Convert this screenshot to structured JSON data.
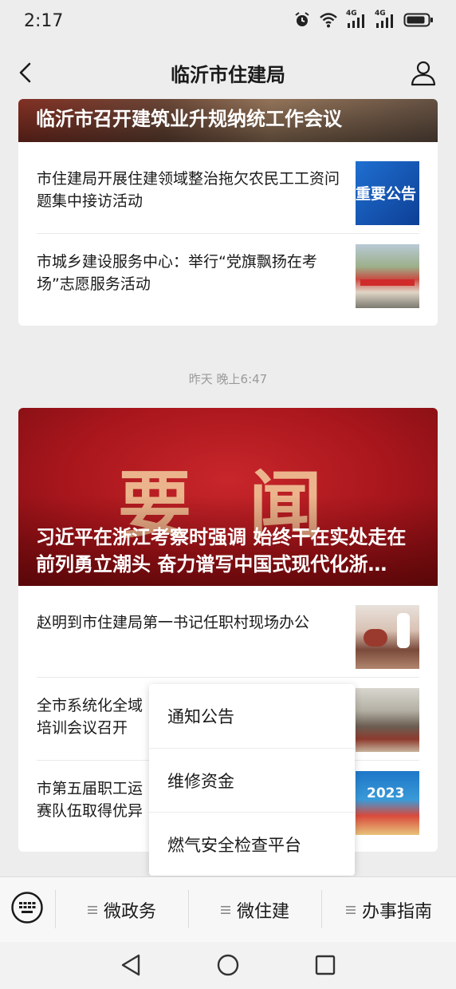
{
  "status_bar": {
    "time": "2:17",
    "icons": [
      "alarm-icon",
      "wifi-icon",
      "signal-4g-1-icon",
      "signal-4g-2-icon",
      "battery-icon"
    ],
    "network_label_1": "4G",
    "network_label_2": "4G"
  },
  "nav": {
    "title": "临沂市住建局",
    "back_icon": "back-arrow-icon",
    "profile_icon": "profile-icon"
  },
  "feed": {
    "group1": {
      "hero_title": "临沂市召开建筑业升规纳统工作会议",
      "items": [
        {
          "text": "市住建局开展住建领域整治拖欠农民工工资问题集中接访活动",
          "thumb_text": "重要公告"
        },
        {
          "text": "市城乡建设服务中心：举行“党旗飘扬在考场”志愿服务活动"
        }
      ]
    },
    "timestamp": "昨天 晚上6:47",
    "group2": {
      "hero_bg_text": "要 闻",
      "hero_title": "习近平在浙江考察时强调 始终干在实处走在前列勇立潮头 奋力谱写中国式现代化浙…",
      "items": [
        {
          "text": "赵明到市住建局第一书记任职村现场办公"
        },
        {
          "text": "全市系统化全域推进海绵城市建设专题培训会议召开",
          "visible_text": "全市系统化全域\n培训会议召开"
        },
        {
          "text": "市第五届职工运动会住建系统参赛队伍取得优异成绩",
          "visible_text": "市第五届职工运\n赛队伍取得优异",
          "thumb_text": "2023"
        }
      ]
    }
  },
  "popup_menu": {
    "items": [
      {
        "label": "通知公告"
      },
      {
        "label": "维修资金"
      },
      {
        "label": "燃气安全检查平台"
      }
    ]
  },
  "bottom_menu": {
    "keyboard_icon": "keyboard-icon",
    "tabs": [
      {
        "label": "微政务",
        "icon": "menu-lines-icon"
      },
      {
        "label": "微住建",
        "icon": "menu-lines-icon"
      },
      {
        "label": "办事指南",
        "icon": "menu-lines-icon"
      }
    ]
  },
  "system_nav": {
    "buttons": [
      "back-triangle-icon",
      "home-circle-icon",
      "recents-square-icon"
    ]
  },
  "colors": {
    "background": "#ededed",
    "card": "#ffffff",
    "hero_red": "#a8161c",
    "gold_text": "#e8b28a",
    "text": "#1a1a1a",
    "muted": "#9a9a9a"
  }
}
